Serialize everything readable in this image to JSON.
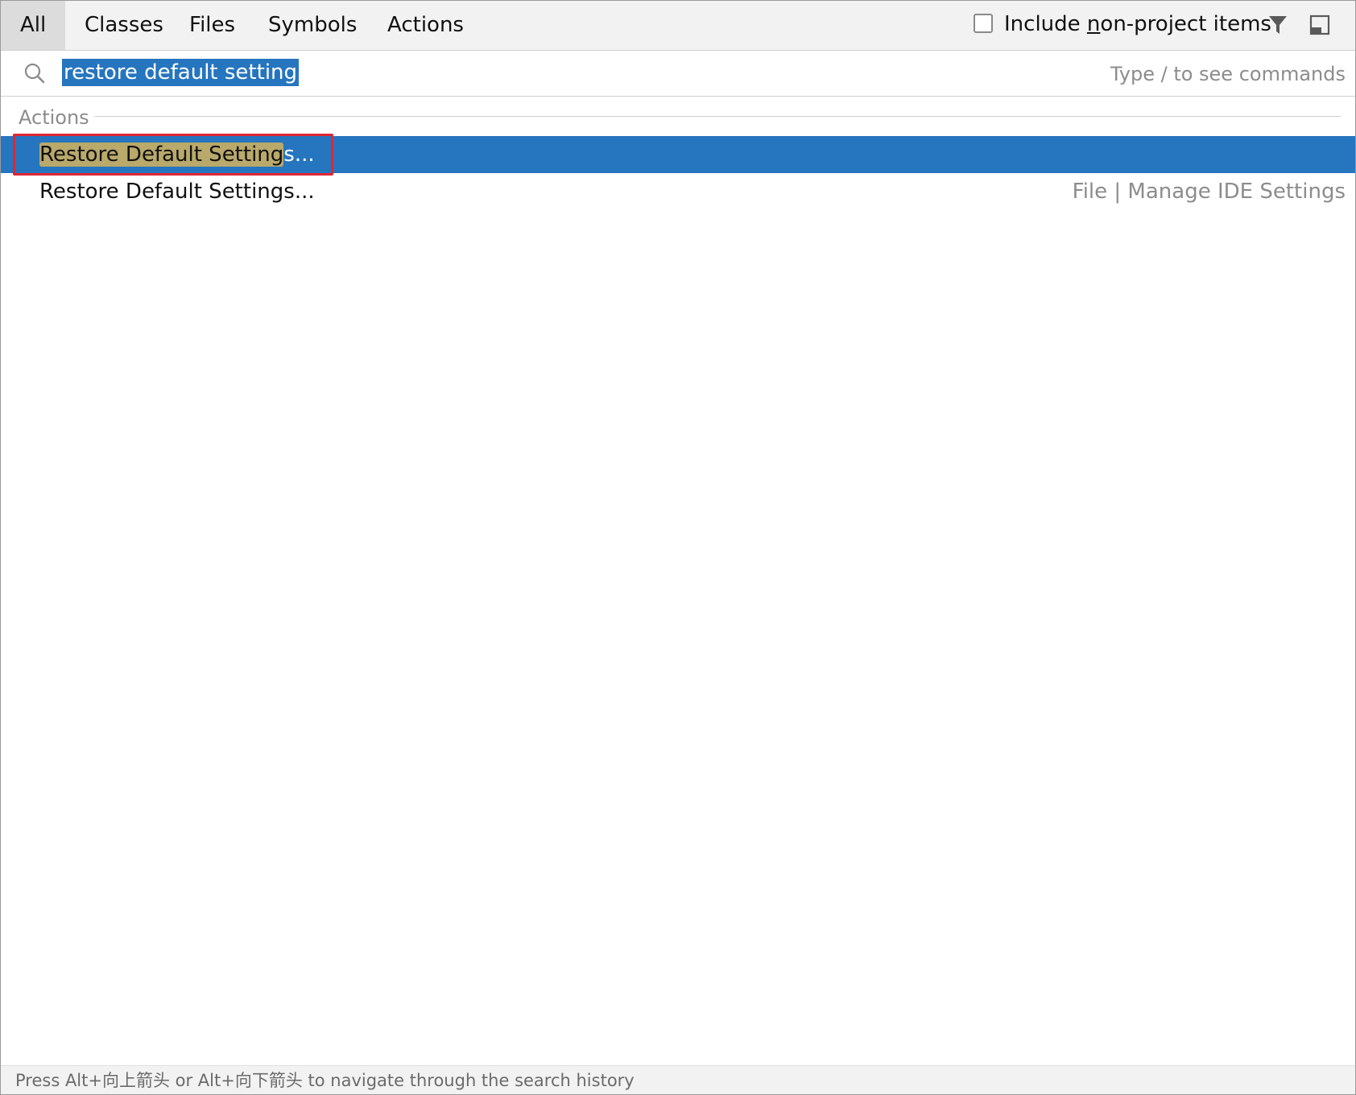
{
  "tabs": [
    {
      "label": "All",
      "selected": true
    },
    {
      "label": "Classes",
      "selected": false
    },
    {
      "label": "Files",
      "selected": false
    },
    {
      "label": "Symbols",
      "selected": false
    },
    {
      "label": "Actions",
      "selected": false
    }
  ],
  "toolbar": {
    "include_label_prefix": "Include ",
    "include_label_mnemonic": "n",
    "include_label_suffix": "on-project items",
    "include_checked": false,
    "filter_icon": "filter-icon",
    "panel_icon": "open-in-panel-icon"
  },
  "search": {
    "icon": "search-icon",
    "value": "restore default setting",
    "hint": "Type / to see commands"
  },
  "results": {
    "group_label": "Actions",
    "items": [
      {
        "match_text": "Restore Default Setting",
        "rest_text": "s...",
        "location": "",
        "selected": true
      },
      {
        "label": "Restore Default Settings...",
        "location": "File | Manage IDE Settings",
        "selected": false
      }
    ]
  },
  "status": {
    "text": "Press Alt+向上箭头 or Alt+向下箭头 to navigate through the search history"
  },
  "colors": {
    "selection": "#2675bf",
    "match_highlight": "#b9a96a",
    "annotation_box": "#e02633",
    "tabbar_bg": "#f2f2f2"
  }
}
